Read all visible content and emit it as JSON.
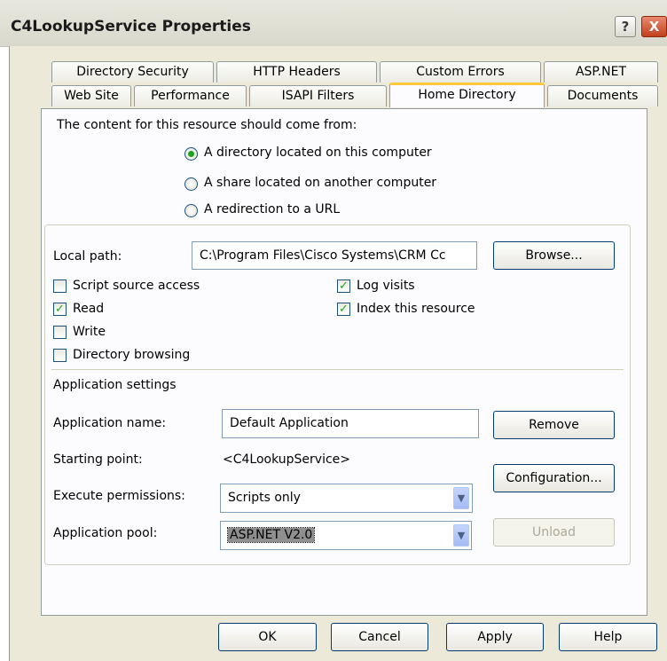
{
  "window": {
    "title": "C4LookupService Properties"
  },
  "titlebar": {
    "help_label": "?",
    "close_label": "X"
  },
  "tabs_row1": [
    "Directory Security",
    "HTTP Headers",
    "Custom Errors",
    "ASP.NET"
  ],
  "tabs_row2": [
    "Web Site",
    "Performance",
    "ISAPI Filters",
    "Home Directory",
    "Documents"
  ],
  "active_tab": "Home Directory",
  "content_source": {
    "prompt": "The content for this resource should come from:",
    "options": [
      {
        "label": "A directory located on this computer",
        "selected": true
      },
      {
        "label": "A share located on another computer",
        "selected": false
      },
      {
        "label": "A redirection to a URL",
        "selected": false
      }
    ]
  },
  "local_path": {
    "label": "Local path:",
    "value": "C:\\Program Files\\Cisco Systems\\CRM Cc",
    "browse_label": "Browse..."
  },
  "permissions": {
    "script_source_access": {
      "label": "Script source access",
      "checked": false
    },
    "read": {
      "label": "Read",
      "checked": true
    },
    "write": {
      "label": "Write",
      "checked": false
    },
    "directory_browsing": {
      "label": "Directory browsing",
      "checked": false
    },
    "log_visits": {
      "label": "Log visits",
      "checked": true
    },
    "index_resource": {
      "label": "Index this resource",
      "checked": true
    }
  },
  "app_settings": {
    "heading": "Application settings",
    "name_label": "Application name:",
    "name_value": "Default Application",
    "remove_label": "Remove",
    "starting_point_label": "Starting point:",
    "starting_point_value": "<C4LookupService>",
    "configuration_label": "Configuration...",
    "execute_label": "Execute permissions:",
    "execute_value": "Scripts only",
    "pool_label": "Application pool:",
    "pool_value": "ASP.NET V2.0",
    "unload_label": "Unload"
  },
  "footer": {
    "ok": "OK",
    "cancel": "Cancel",
    "apply": "Apply",
    "help": "Help"
  },
  "colors": {
    "accent_tab": "#ffc83c",
    "check": "#21a121",
    "button_border": "#003c74"
  }
}
